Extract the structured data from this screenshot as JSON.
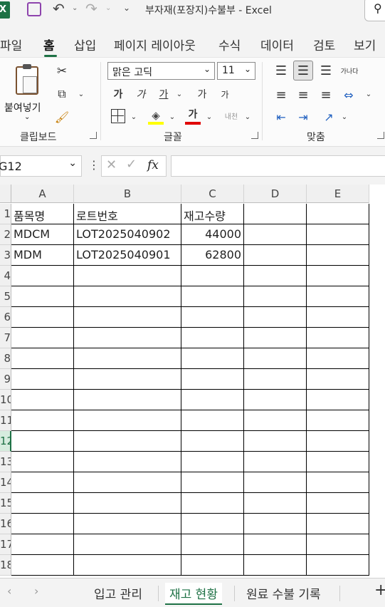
{
  "window": {
    "title": "부자재(포장지)수불부  -  Excel"
  },
  "menu": {
    "tabs": [
      "파일",
      "홈",
      "삽입",
      "페이지 레이아웃",
      "수식",
      "데이터",
      "검토",
      "보기"
    ],
    "active_index": 1
  },
  "ribbon": {
    "clipboard": {
      "paste_label": "붙여넣기",
      "group_label": "클립보드"
    },
    "font": {
      "font_name": "맑은 고딕",
      "font_size": "11",
      "group_label": "글꼴",
      "bold": "가",
      "italic": "가",
      "underline": "가",
      "grow": "가",
      "shrink": "가",
      "font_color": "가",
      "phonetic": "내천"
    },
    "alignment": {
      "group_label": "맞춤",
      "wrap_hint": "가나다"
    }
  },
  "formula_bar": {
    "name_box": "G12",
    "fx_label": "fx",
    "value": ""
  },
  "grid": {
    "columns": [
      "A",
      "B",
      "C",
      "D",
      "E"
    ],
    "rows": [
      {
        "num": "1",
        "cells": [
          "품목명",
          "로트번호",
          "재고수량",
          "",
          ""
        ]
      },
      {
        "num": "2",
        "cells": [
          "MDCM",
          "LOT2025040902",
          "44000",
          "",
          ""
        ]
      },
      {
        "num": "3",
        "cells": [
          "MDM",
          "LOT2025040901",
          "62800",
          "",
          ""
        ]
      },
      {
        "num": "4",
        "cells": [
          "",
          "",
          "",
          "",
          ""
        ]
      },
      {
        "num": "5",
        "cells": [
          "",
          "",
          "",
          "",
          ""
        ]
      },
      {
        "num": "6",
        "cells": [
          "",
          "",
          "",
          "",
          ""
        ]
      },
      {
        "num": "7",
        "cells": [
          "",
          "",
          "",
          "",
          ""
        ]
      },
      {
        "num": "8",
        "cells": [
          "",
          "",
          "",
          "",
          ""
        ]
      },
      {
        "num": "9",
        "cells": [
          "",
          "",
          "",
          "",
          ""
        ]
      },
      {
        "num": "10",
        "cells": [
          "",
          "",
          "",
          "",
          ""
        ]
      },
      {
        "num": "11",
        "cells": [
          "",
          "",
          "",
          "",
          ""
        ]
      },
      {
        "num": "12",
        "cells": [
          "",
          "",
          "",
          "",
          ""
        ]
      },
      {
        "num": "13",
        "cells": [
          "",
          "",
          "",
          "",
          ""
        ]
      },
      {
        "num": "14",
        "cells": [
          "",
          "",
          "",
          "",
          ""
        ]
      },
      {
        "num": "15",
        "cells": [
          "",
          "",
          "",
          "",
          ""
        ]
      },
      {
        "num": "16",
        "cells": [
          "",
          "",
          "",
          "",
          ""
        ]
      },
      {
        "num": "17",
        "cells": [
          "",
          "",
          "",
          "",
          ""
        ]
      },
      {
        "num": "18",
        "cells": [
          "",
          "",
          "",
          "",
          ""
        ]
      }
    ],
    "selected_row": "12"
  },
  "sheets": {
    "tabs": [
      "입고 관리",
      "재고 현황",
      "원료 수불 기록"
    ],
    "active_index": 1,
    "add_label": "+"
  },
  "colors": {
    "accent": "#1e7145",
    "font_color_bar": "#e00000",
    "highlight_bar": "#ffff00"
  }
}
